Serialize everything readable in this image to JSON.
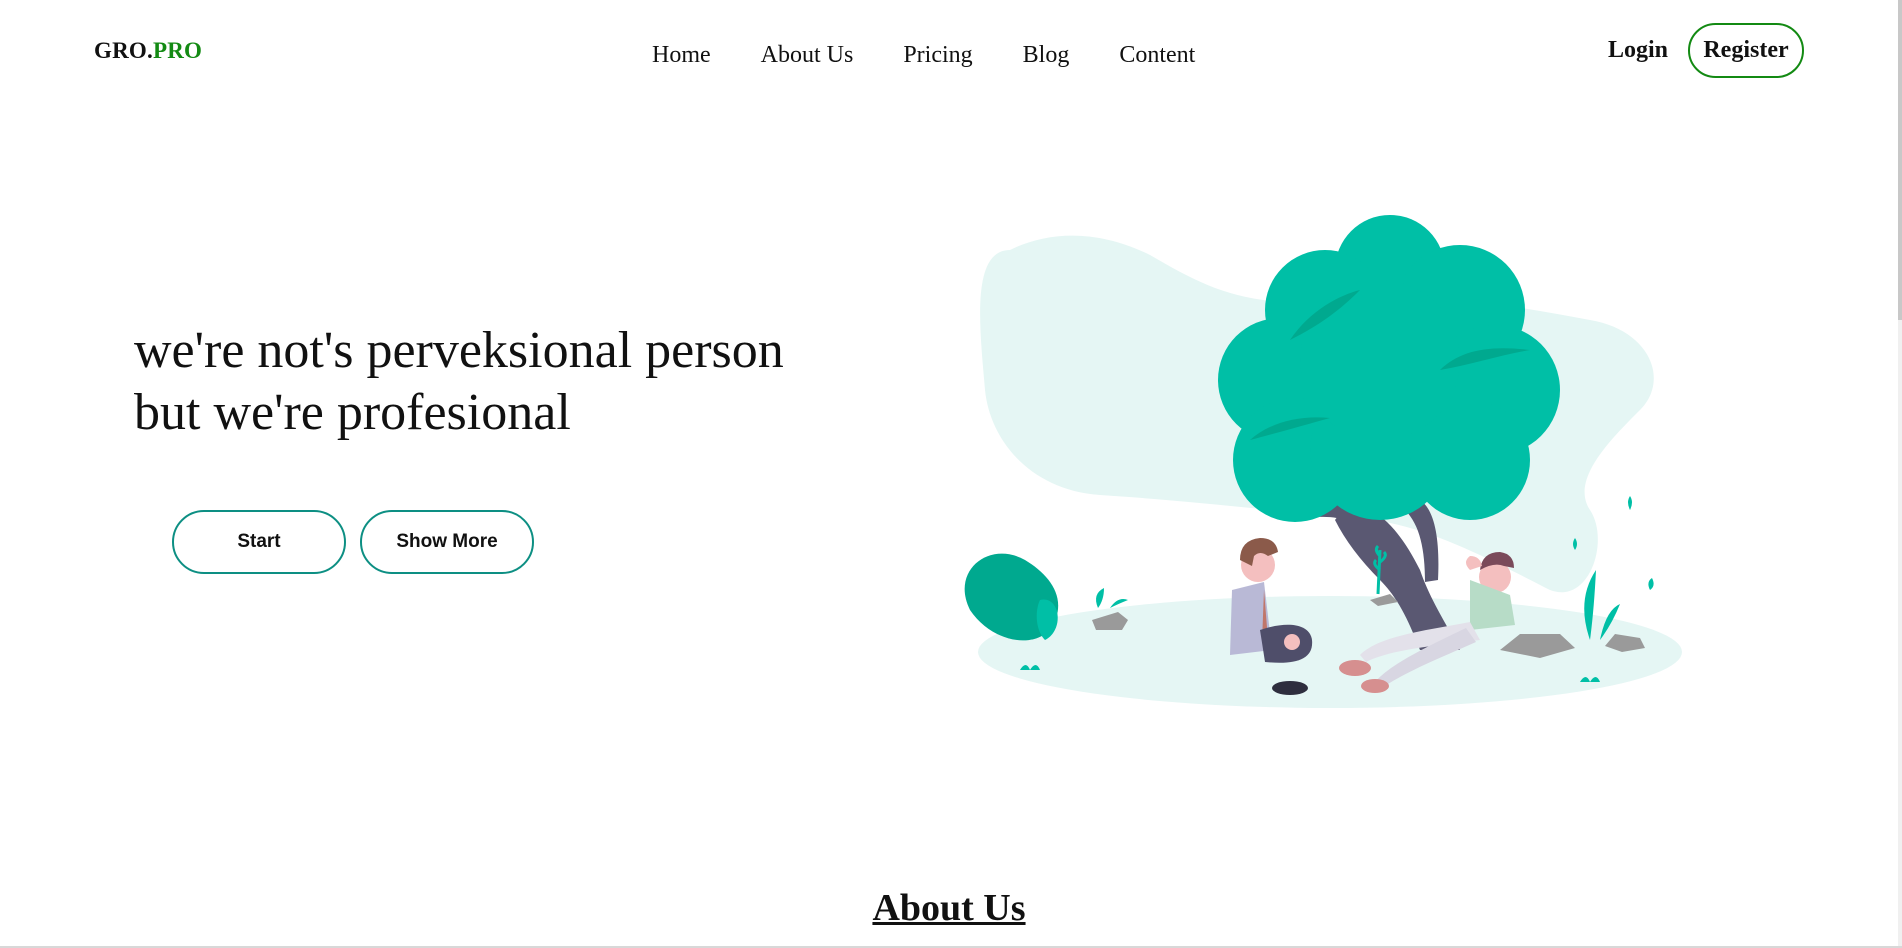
{
  "header": {
    "brand_part1": "GRO.",
    "brand_part2": "PRO",
    "nav": [
      {
        "label": "Home"
      },
      {
        "label": "About Us"
      },
      {
        "label": "Pricing"
      },
      {
        "label": "Blog"
      },
      {
        "label": "Content"
      }
    ],
    "login_label": "Login",
    "register_label": "Register"
  },
  "hero": {
    "headline_line1": "we're not's perveksional person",
    "headline_line2": "but we're profesional",
    "start_label": "Start",
    "show_more_label": "Show More",
    "illustration": "two-people-under-tree-illustration"
  },
  "about": {
    "title": "About Us"
  },
  "colors": {
    "brand_accent": "#138a13",
    "button_border": "#0d8f83",
    "tree_green": "#00bfa6",
    "blob": "#e5f6f4"
  }
}
